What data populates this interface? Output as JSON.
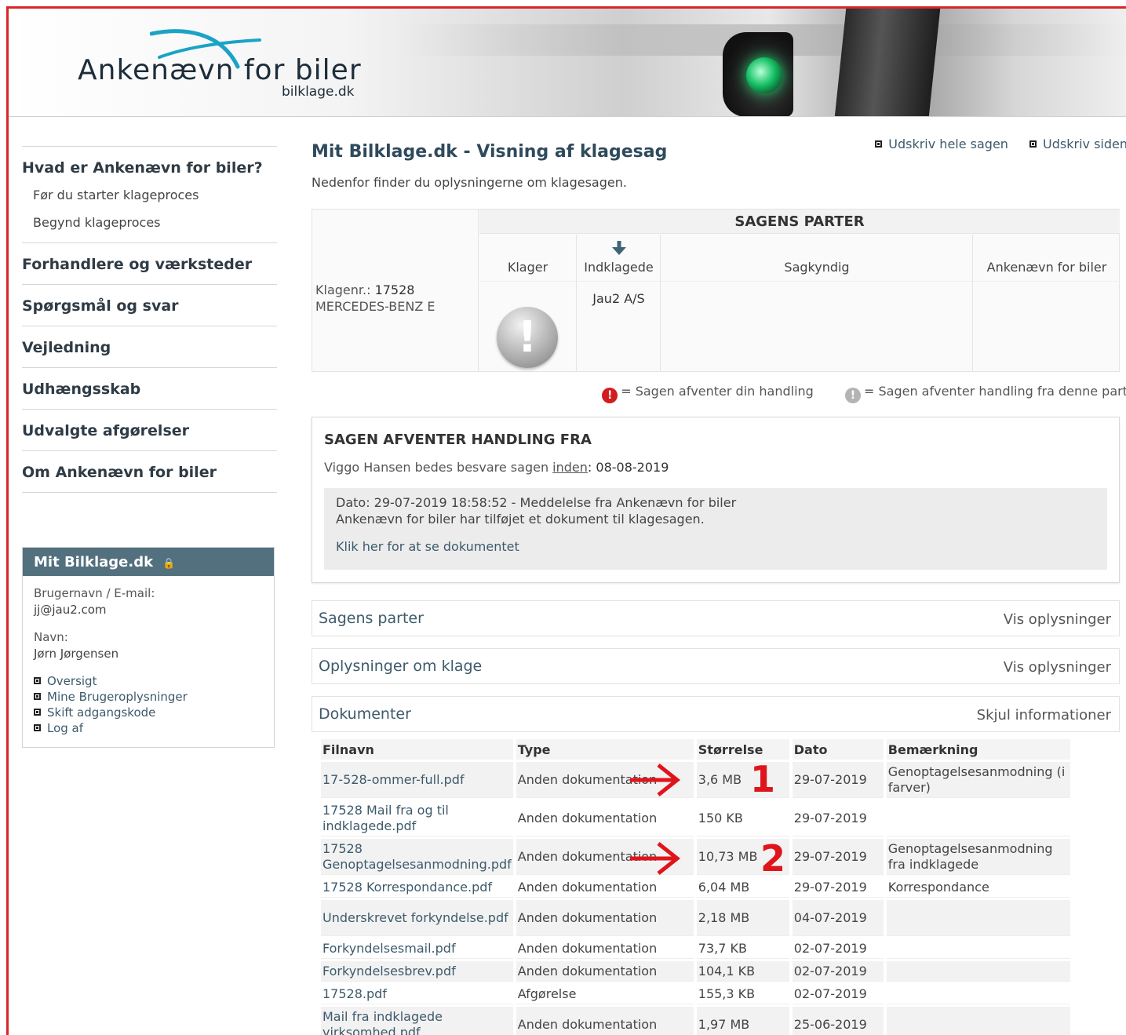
{
  "header": {
    "logo_title": "Ankenævn for biler",
    "logo_sub": "bilklage.dk"
  },
  "sidebar": {
    "items": [
      {
        "label": "Hvad er Ankenævn for biler?",
        "sub": [
          "Før du starter klageproces",
          "Begynd klageproces"
        ]
      },
      {
        "label": "Forhandlere og værksteder"
      },
      {
        "label": "Spørgsmål og svar"
      },
      {
        "label": "Vejledning"
      },
      {
        "label": "Udhængsskab"
      },
      {
        "label": "Udvalgte afgørelser"
      },
      {
        "label": "Om Ankenævn for biler"
      }
    ]
  },
  "mypanel": {
    "title": "Mit Bilklage.dk",
    "user_label": "Brugernavn / E-mail:",
    "user_value": "jj@jau2.com",
    "name_label": "Navn:",
    "name_value": "Jørn Jørgensen",
    "links": [
      "Oversigt",
      "Mine Brugeroplysninger",
      "Skift adgangskode",
      "Log af"
    ]
  },
  "main": {
    "title": "Mit Bilklage.dk - Visning af klagesag",
    "intro": "Nedenfor finder du oplysningerne om klagesagen.",
    "print_all": "Udskriv hele sagen",
    "print_page": "Udskriv siden"
  },
  "parties": {
    "header": "SAGENS PARTER",
    "case_label": "Klagenr.:",
    "case_no": "17528",
    "car": "MERCEDES-BENZ E",
    "cols": [
      "Klager",
      "Indklagede",
      "Sagkyndig",
      "Ankenævn for biler"
    ],
    "indklagede_name": "Jau2 A/S"
  },
  "legend": {
    "red": "= Sagen afventer din handling",
    "grey": "= Sagen afventer handling fra denne part"
  },
  "await": {
    "title": "SAGEN AFVENTER HANDLING FRA",
    "req_pre": "Viggo Hansen bedes besvare sagen ",
    "req_link": "inden",
    "req_date": ": 08-08-2019",
    "line1": "Dato: 29-07-2019 18:58:52 - Meddelelse fra Ankenævn for biler",
    "line2": "Ankenævn for biler har tilføjet et dokument til klagesagen.",
    "link": "Klik her for at se dokumentet"
  },
  "accordions": [
    {
      "title": "Sagens parter",
      "action": "Vis oplysninger"
    },
    {
      "title": "Oplysninger om klage",
      "action": "Vis oplysninger"
    },
    {
      "title": "Dokumenter",
      "action": "Skjul informationer"
    }
  ],
  "documents": {
    "columns": [
      "Filnavn",
      "Type",
      "Størrelse",
      "Dato",
      "Bemærkning"
    ],
    "rows": [
      {
        "file": "17-528-ommer-full.pdf",
        "type": "Anden dokumentation",
        "size": "3,6 MB",
        "date": "29-07-2019",
        "note": "Genoptagelsesanmodning (i farver)"
      },
      {
        "file": "17528 Mail fra og til indklagede.pdf",
        "type": "Anden dokumentation",
        "size": "150 KB",
        "date": "29-07-2019",
        "note": ""
      },
      {
        "file": "17528 Genoptagelsesanmodning.pdf",
        "type": "Anden dokumentation",
        "size": "10,73 MB",
        "date": "29-07-2019",
        "note": "Genoptagelsesanmodning fra indklagede"
      },
      {
        "file": "17528 Korrespondance.pdf",
        "type": "Anden dokumentation",
        "size": "6,04 MB",
        "date": "29-07-2019",
        "note": "Korrespondance"
      },
      {
        "file": "Underskrevet forkyndelse.pdf",
        "type": "Anden dokumentation",
        "size": "2,18 MB",
        "date": "04-07-2019",
        "note": ""
      },
      {
        "file": "Forkyndelsesmail.pdf",
        "type": "Anden dokumentation",
        "size": "73,7 KB",
        "date": "02-07-2019",
        "note": ""
      },
      {
        "file": "Forkyndelsesbrev.pdf",
        "type": "Anden dokumentation",
        "size": "104,1 KB",
        "date": "02-07-2019",
        "note": ""
      },
      {
        "file": "17528.pdf",
        "type": "Afgørelse",
        "size": "155,3 KB",
        "date": "02-07-2019",
        "note": ""
      },
      {
        "file": "Mail fra indklagede virksomhed.pdf",
        "type": "Anden dokumentation",
        "size": "1,97 MB",
        "date": "25-06-2019",
        "note": ""
      }
    ]
  },
  "annotations": {
    "one": "1",
    "two": "2",
    "color": "#e0141b"
  }
}
